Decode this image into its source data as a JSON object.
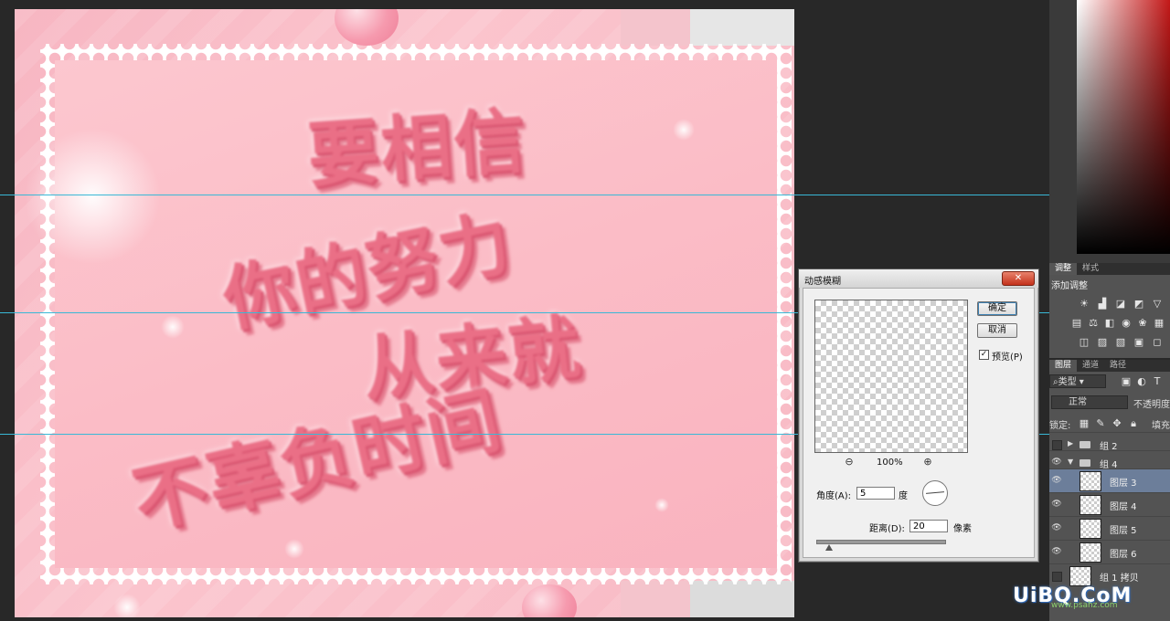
{
  "canvas": {
    "headline_lines": [
      "要相信",
      "你的努力",
      "从来就",
      "不辜负时间"
    ]
  },
  "panels": {
    "adjustments_tabs": [
      "调整",
      "样式"
    ],
    "adjustments_label": "添加调整",
    "adjustment_icons": [
      "brightness-icon",
      "levels-icon",
      "curves-icon",
      "exposure-icon",
      "vibrance-icon",
      "hue-saturation-icon",
      "color-balance-icon",
      "black-white-icon",
      "photo-filter-icon",
      "channel-mixer-icon",
      "color-lookup-icon",
      "invert-icon",
      "posterize-icon",
      "threshold-icon",
      "selective-color-icon",
      "gradient-map-icon"
    ],
    "layers_tabs": [
      "图层",
      "通道",
      "路径"
    ],
    "kind_filter": "类型",
    "blend_mode": "正常",
    "opacity_label": "不透明度",
    "lock_label": "锁定:",
    "fill_label": "填充",
    "layers": [
      {
        "name": "组 2",
        "type": "group",
        "expanded": false,
        "visible": false
      },
      {
        "name": "组 4",
        "type": "group",
        "expanded": true,
        "visible": true
      },
      {
        "name": "图层 3",
        "type": "layer",
        "selected": true,
        "visible": true
      },
      {
        "name": "图层 4",
        "type": "layer",
        "visible": true
      },
      {
        "name": "图层 5",
        "type": "layer",
        "visible": true
      },
      {
        "name": "图层 6",
        "type": "layer",
        "visible": true
      },
      {
        "name": "组 1 拷贝",
        "type": "layer",
        "visible": false
      }
    ]
  },
  "dialog": {
    "title": "动感模糊",
    "close": "✕",
    "ok": "确定",
    "cancel": "取消",
    "preview_label": "预览(P)",
    "preview_checked": true,
    "zoom_level": "100%",
    "angle_label": "角度(A):",
    "angle_value": "5",
    "angle_unit": "度",
    "distance_label": "距离(D):",
    "distance_value": "20",
    "distance_unit": "像素"
  },
  "watermark": {
    "logo": "UiBQ.CoM",
    "url": "www.psahz.com"
  },
  "colors": {
    "canvas_pink": "#fbc4cd",
    "headline": "#ea6f86",
    "guide": "#39b8d6",
    "selected_layer": "#6c7e9a"
  }
}
